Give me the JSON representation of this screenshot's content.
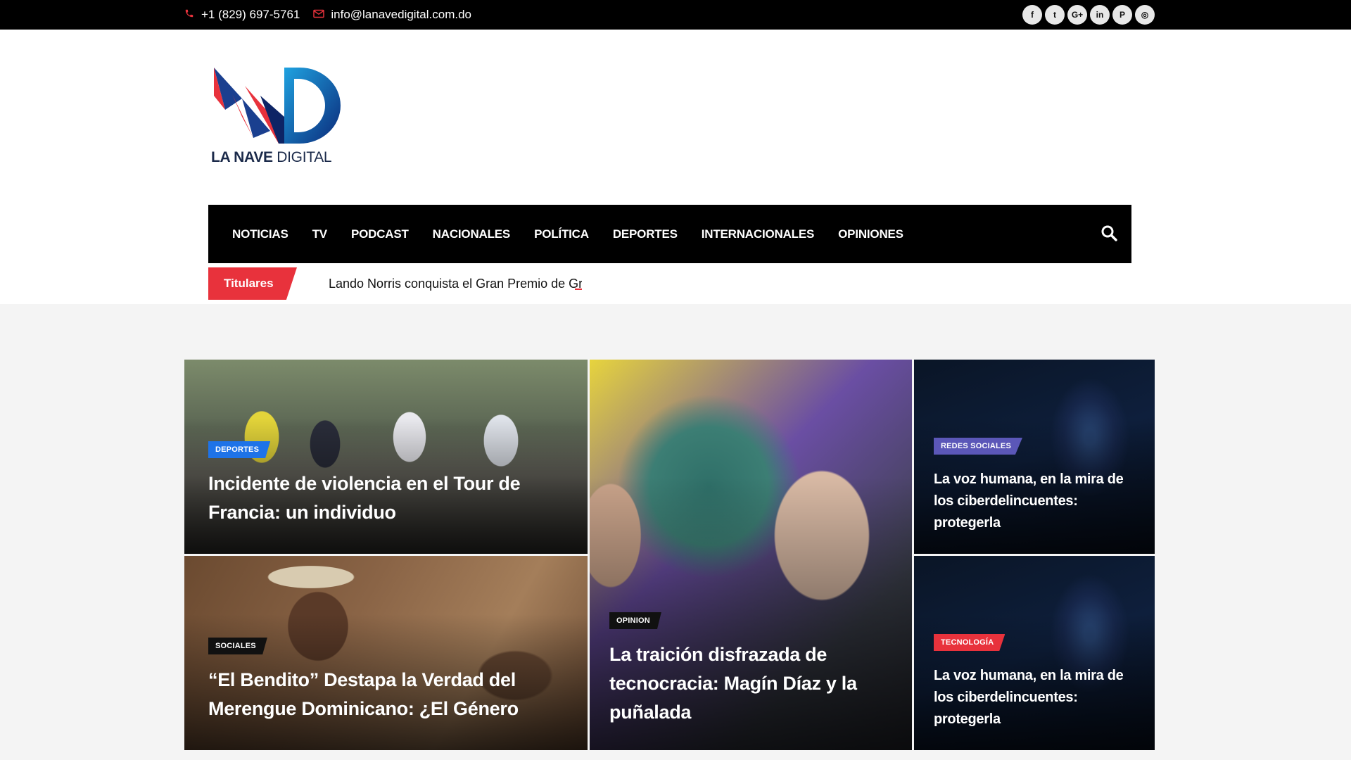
{
  "topbar": {
    "phone": "+1 (829) 697-5761",
    "email": "info@lanavedigital.com.do",
    "phone_icon": "phone-icon",
    "email_icon": "envelope-icon",
    "socials": [
      {
        "name": "facebook-icon",
        "glyph": "f"
      },
      {
        "name": "twitter-icon",
        "glyph": "t"
      },
      {
        "name": "google-plus-icon",
        "glyph": "G+"
      },
      {
        "name": "linkedin-icon",
        "glyph": "in"
      },
      {
        "name": "pinterest-icon",
        "glyph": "P"
      },
      {
        "name": "instagram-icon",
        "glyph": "◎"
      }
    ]
  },
  "logo": {
    "text_bold": "LA NAVE",
    "text_light": " DIGITAL"
  },
  "nav": {
    "items": [
      "NOTICIAS",
      "TV",
      "PODCAST",
      "NACIONALES",
      "POLÍTICA",
      "DEPORTES",
      "INTERNACIONALES",
      "OPINIONES"
    ],
    "search_icon": "search-icon"
  },
  "ticker": {
    "label": "Titulares",
    "text": "Lando Norris conquista el Gran Premio de Gran Bretaña"
  },
  "cards": [
    {
      "category": "DEPORTES",
      "badge_color": "#1e73e8",
      "title": "Incidente de violencia en el Tour de Francia: un individuo"
    },
    {
      "category": "SOCIALES",
      "badge_color": "#111111",
      "title": "“El Bendito” Destapa la Verdad del Merengue Dominicano: ¿El Género"
    },
    {
      "category": "OPINION",
      "badge_color": "#111111",
      "title": "La traición disfrazada de tecnocracia: Magín Díaz y la puñalada"
    },
    {
      "category": "REDES SOCIALES",
      "badge_color": "#5b57b8",
      "title": "La voz humana, en la mira de los ciberdelincuentes: protegerla"
    },
    {
      "category": "TECNOLOGÍA",
      "badge_color": "#e8323c",
      "title": "La voz humana, en la mira de los ciberdelincuentes: protegerla"
    }
  ]
}
